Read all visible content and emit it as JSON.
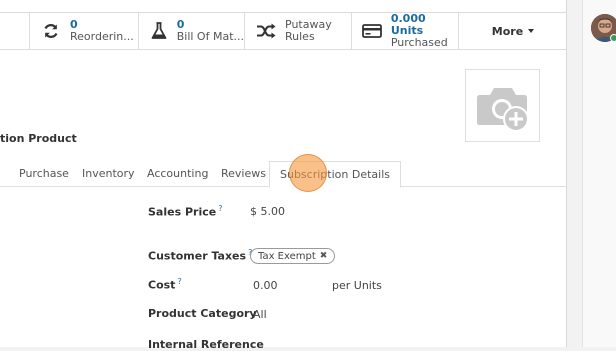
{
  "smart_buttons": [
    {
      "num": "0",
      "label": "Reorderin...",
      "icon": "refresh-icon"
    },
    {
      "num": "0",
      "label": "Bill Of Mat...",
      "icon": "flask-icon"
    },
    {
      "num": "",
      "label1": "Putaway",
      "label2": "Rules",
      "icon": "shuffle-icon"
    },
    {
      "num": "0.000 Units",
      "label": "Purchased",
      "icon": "credit-card-icon"
    }
  ],
  "more_label": "More",
  "product_name_fragment": "tion Product",
  "tabs": [
    "Purchase",
    "Inventory",
    "Accounting",
    "Reviews",
    "Subscription Details"
  ],
  "fields": {
    "sales_price": {
      "label": "Sales Price",
      "help": "?",
      "value": "$ 5.00"
    },
    "customer_taxes": {
      "label": "Customer Taxes",
      "help": "?",
      "tag": "Tax Exempt"
    },
    "cost": {
      "label": "Cost",
      "help": "?",
      "value": "0.00",
      "unit": "per Units"
    },
    "product_category": {
      "label": "Product Category",
      "value": "All"
    },
    "internal_reference": {
      "label": "Internal Reference"
    }
  },
  "colors": {
    "accent": "#1b6aa0",
    "cursor": "#f5963c"
  }
}
